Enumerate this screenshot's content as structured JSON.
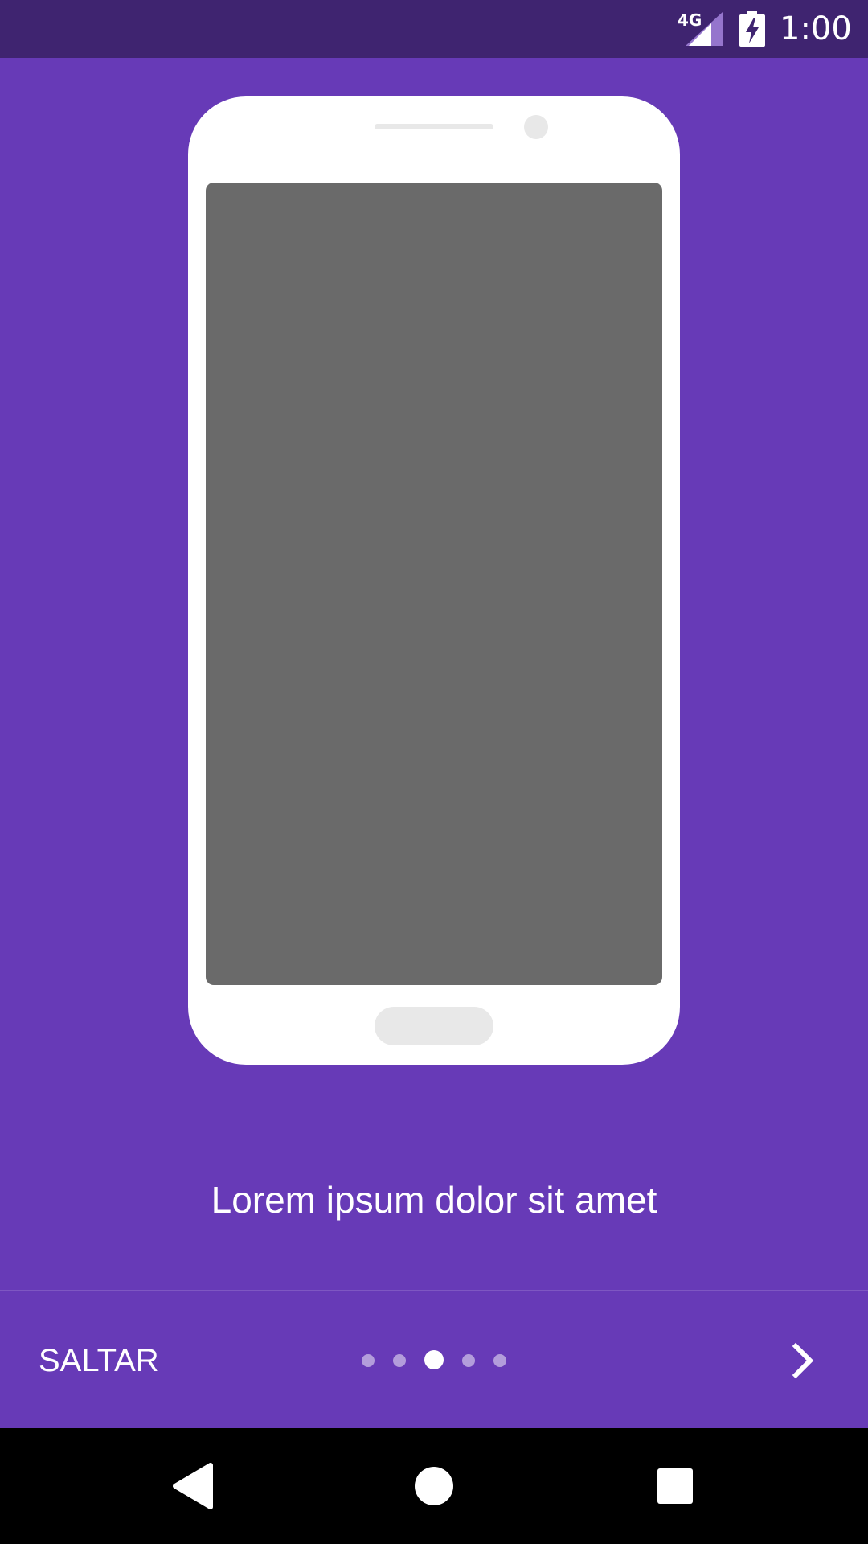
{
  "status_bar": {
    "network": "4G",
    "time": "1:00"
  },
  "onboarding": {
    "title": "Lorem ipsum dolor sit amet"
  },
  "controls": {
    "skip_label": "SALTAR",
    "page_count": 5,
    "current_page": 3
  },
  "colors": {
    "background": "#673ab7",
    "status_bar": "#3f2470",
    "phone_body": "#ffffff",
    "phone_screen": "#6a6a6a"
  },
  "icons": {
    "next": "chevron-right-icon",
    "back": "back-triangle-icon",
    "home": "home-circle-icon",
    "recents": "recents-square-icon"
  }
}
